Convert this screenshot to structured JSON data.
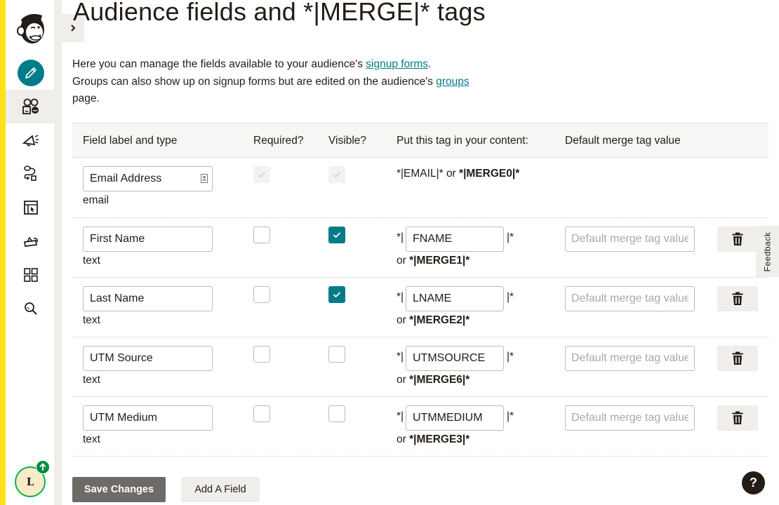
{
  "page": {
    "title": "Audience fields and *|MERGE|* tags",
    "intro_line1_pre": "Here you can manage the fields available to your audience's ",
    "intro_link1": "signup forms",
    "intro_line1_post": ".",
    "intro_line2_pre": "Groups can also show up on signup forms but are edited on the audience's ",
    "intro_link2": "groups",
    "intro_line2_post": " page."
  },
  "sidebar": {
    "items": [
      {
        "name": "create",
        "icon": "pencil-icon"
      },
      {
        "name": "audience",
        "icon": "audience-icon",
        "active": true
      },
      {
        "name": "campaigns",
        "icon": "megaphone-icon"
      },
      {
        "name": "automations",
        "icon": "automation-icon"
      },
      {
        "name": "website",
        "icon": "website-icon"
      },
      {
        "name": "content-studio",
        "icon": "integrations-icon"
      },
      {
        "name": "dashboard",
        "icon": "grid-icon"
      },
      {
        "name": "search",
        "icon": "search-icon"
      }
    ],
    "avatar_initial": "L",
    "expand_icon": "chevron-right-icon"
  },
  "table": {
    "headers": {
      "field": "Field label and type",
      "required": "Required?",
      "visible": "Visible?",
      "tag": "Put this tag in your content:",
      "default": "Default merge tag value"
    },
    "email_row": {
      "label": "Email Address",
      "type": "email",
      "required": true,
      "visible": true,
      "tag_text": "*|EMAIL|* or ",
      "merge": "*|MERGE0|*"
    },
    "rows": [
      {
        "label": "First Name",
        "type": "text",
        "required": false,
        "visible": true,
        "tag": "FNAME",
        "merge": "*|MERGE1|*",
        "default_value": ""
      },
      {
        "label": "Last Name",
        "type": "text",
        "required": false,
        "visible": true,
        "tag": "LNAME",
        "merge": "*|MERGE2|*",
        "default_value": ""
      },
      {
        "label": "UTM Source",
        "type": "text",
        "required": false,
        "visible": false,
        "tag": "UTMSOURCE",
        "merge": "*|MERGE6|*",
        "default_value": ""
      },
      {
        "label": "UTM Medium",
        "type": "text",
        "required": false,
        "visible": false,
        "tag": "UTMMEDIUM",
        "merge": "*|MERGE3|*",
        "default_value": ""
      }
    ],
    "tag_prefix": "*|",
    "tag_suffix": "|*",
    "or_label": "or ",
    "default_placeholder": "Default merge tag value"
  },
  "actions": {
    "save_label": "Save Changes",
    "add_label": "Add A Field"
  },
  "feedback_label": "Feedback",
  "help_label": "?",
  "colors": {
    "brand_yellow": "#ffe01b",
    "accent_teal": "#007c89",
    "save_button": "#6e6a66",
    "avatar_ring": "#00b545"
  }
}
